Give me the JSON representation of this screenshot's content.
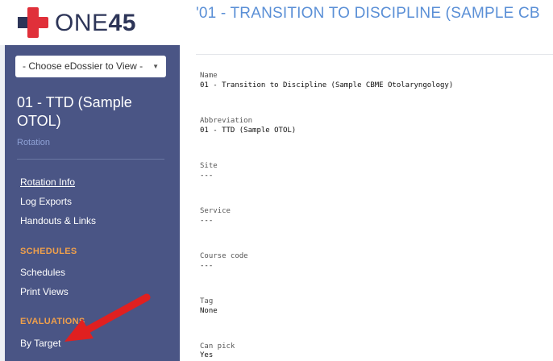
{
  "logo": {
    "text_light": "ONE",
    "text_bold": "45"
  },
  "sidebar": {
    "dossier_select": "- Choose eDossier to View -",
    "course_title": "01 - TTD (Sample OTOL)",
    "course_type": "Rotation",
    "links": [
      {
        "label": "Rotation Info",
        "active": true
      },
      {
        "label": "Log Exports"
      },
      {
        "label": "Handouts & Links"
      }
    ],
    "schedules_heading": "SCHEDULES",
    "schedule_links": [
      {
        "label": "Schedules"
      },
      {
        "label": "Print Views"
      }
    ],
    "evaluations_heading": "EVALUATIONS",
    "evaluation_links": [
      {
        "label": "By Target"
      }
    ]
  },
  "main": {
    "title": "'01 - TRANSITION TO DISCIPLINE (SAMPLE CB",
    "fields": [
      {
        "label": "Name",
        "value": "01 - Transition to Discipline (Sample CBME Otolaryngology)"
      },
      {
        "label": "Abbreviation",
        "value": "01 - TTD (Sample OTOL)"
      },
      {
        "label": "Site",
        "value": "---"
      },
      {
        "label": "Service",
        "value": "---"
      },
      {
        "label": "Course code",
        "value": "---"
      },
      {
        "label": "Tag",
        "value": "None"
      },
      {
        "label": "Can pick",
        "value": "Yes"
      }
    ]
  },
  "colors": {
    "sidebar_bg": "#4a5585",
    "accent_orange": "#f0a04b",
    "title_blue": "#5a8fd6",
    "logo_red": "#e0303a",
    "arrow_red": "#e02020"
  },
  "icons": {
    "logo_mark": "medical-cross-icon",
    "select_caret": "caret-down-icon",
    "annotation": "red-arrow-icon"
  }
}
